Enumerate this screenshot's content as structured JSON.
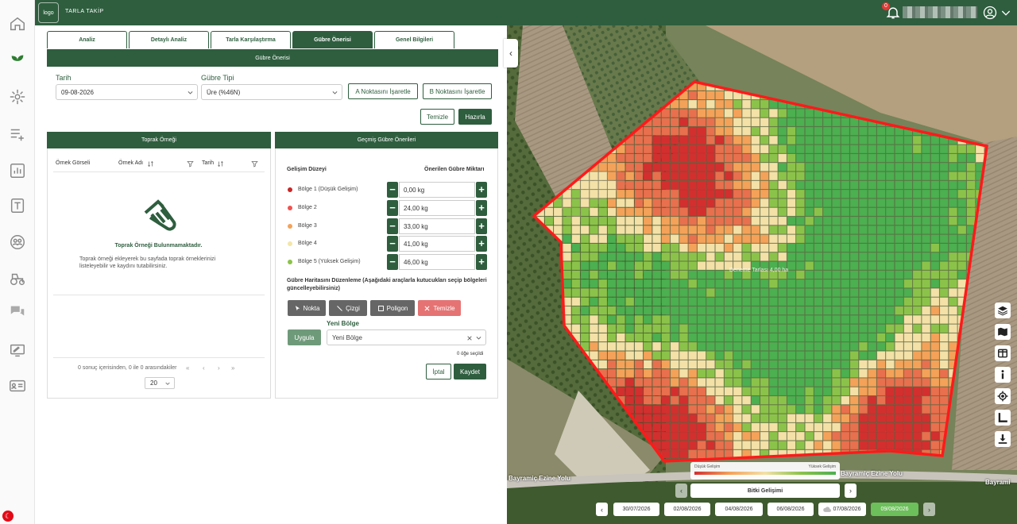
{
  "topbar": {
    "logo": "logo",
    "app_name": "TARLA TAKİP",
    "notification_count": "0"
  },
  "tabs": [
    "Analiz",
    "Detaylı Analiz",
    "Tarla Karşılaştırma",
    "Gübre Önerisi",
    "Genel Bilgileri"
  ],
  "active_tab": "Gübre Önerisi",
  "fertilizer": {
    "header": "Gübre Önerisi",
    "date_label": "Tarih",
    "date_value": "09-08-2026",
    "type_label": "Gübre Tipi",
    "type_value": "Üre (%46N)",
    "point_a": "A Noktasını İşaretle",
    "point_b": "B Noktasını İşaretle",
    "clear": "Temizle",
    "prepare": "Hazırla"
  },
  "soil": {
    "header": "Toprak Örneği",
    "columns": [
      "Örnek Görseli",
      "Örnek Adı",
      "Tarih"
    ],
    "empty_title": "Toprak Örneği Bulunmamaktadır.",
    "empty_desc": "Toprak örneği ekleyerek bu sayfada toprak örneklerinizi listeleyebilir ve kaydını tutabilirsiniz.",
    "pager_text": "0 sonuç içerisinden, 0 ile 0 arasındakiler",
    "page_size": "20"
  },
  "history": {
    "header": "Geçmiş Gübre Önerileri",
    "level_label": "Gelişim Düzeyi",
    "amount_label": "Önerilen Gübre Miktarı",
    "zones": [
      {
        "name": "Bölge 1 (Düşük Gelişim)",
        "amount": "0,00 kg",
        "color": "#c62828"
      },
      {
        "name": "Bölge 2",
        "amount": "24,00 kg",
        "color": "#ef5350"
      },
      {
        "name": "Bölge 3",
        "amount": "33,00 kg",
        "color": "#f4a259"
      },
      {
        "name": "Bölge 4",
        "amount": "41,00 kg",
        "color": "#f3e6a8"
      },
      {
        "name": "Bölge 5 (Yüksek Gelişim)",
        "amount": "46,00 kg",
        "color": "#8bc34a"
      }
    ],
    "edit_help": "Gübre Haritasını Düzenleme (Aşağıdaki araçlarla kutucukları seçip bölgeleri güncelleyebilirsiniz)",
    "tools": {
      "point": "Nokta",
      "line": "Çizgi",
      "polygon": "Poligon",
      "clear": "Temizle"
    },
    "apply": "Uygula",
    "new_zone_label": "Yeni Bölge",
    "new_zone_value": "Yeni Bölge",
    "selected_count": "0 öğe seçildi",
    "cancel": "İptal",
    "save": "Kaydet"
  },
  "map": {
    "legend_low": "Düşük Gelişim",
    "legend_high": "Yüksek Gelişim",
    "layer": "Bitki Gelişimi",
    "road_left": "Bayramiç Ezine Yolu",
    "road_right": "Bayramiç Ezine Yolu",
    "road_far": "Bayrami",
    "field_label": "Deneme Tarlası 4,00 ha",
    "dates": [
      "30/07/2026",
      "02/08/2026",
      "04/08/2026",
      "06/08/2026",
      "07/08/2026",
      "09/08/2026"
    ],
    "active_date": "09/08/2026",
    "colors": {
      "low": "#d32f2f",
      "mid_low": "#f4a259",
      "mid": "#f3e1a8",
      "mid_high": "#8bc34a",
      "high": "#4caf50",
      "boundary": "#ff1a1a"
    }
  }
}
